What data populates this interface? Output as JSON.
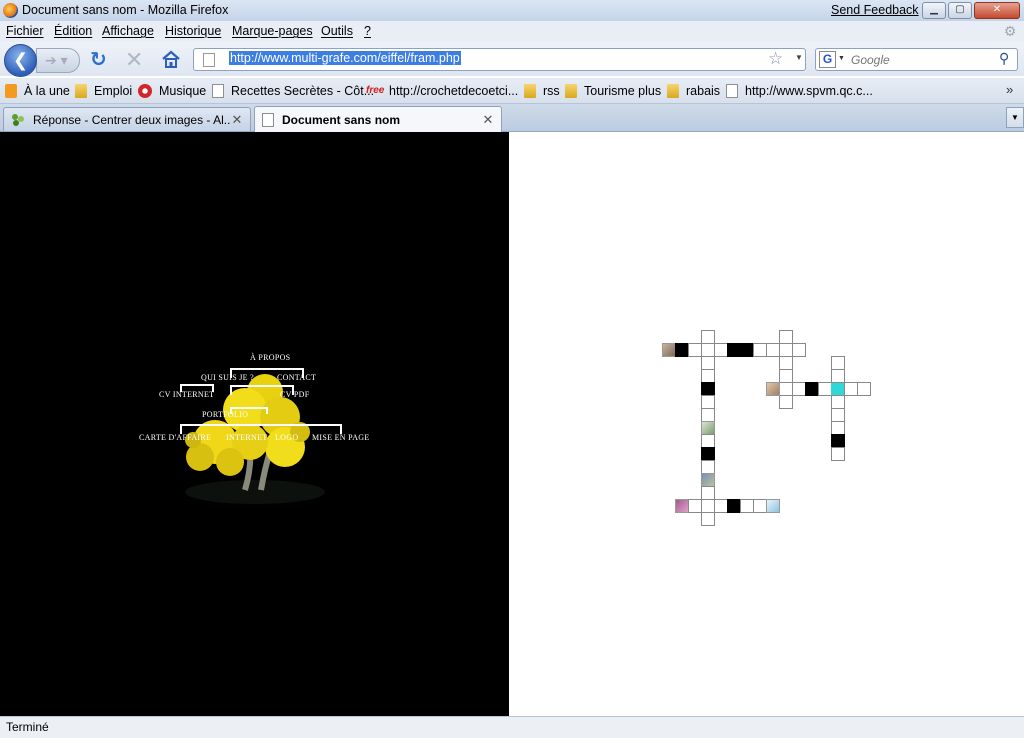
{
  "window": {
    "title": "Document sans nom - Mozilla Firefox",
    "feedback": "Send Feedback",
    "min": "▁",
    "max": "▢",
    "close": "✕"
  },
  "menu": {
    "items": [
      "Fichier",
      "Édition",
      "Affichage",
      "Historique",
      "Marque-pages",
      "Outils",
      "?"
    ]
  },
  "nav": {
    "url": "http://www.multi-grafe.com/eiffel/fram.php",
    "search_placeholder": "Google"
  },
  "bookmarks": {
    "items": [
      {
        "label": "À la une",
        "icon": "rss-icon"
      },
      {
        "label": "Emploi",
        "icon": "folder-icon"
      },
      {
        "label": "Musique",
        "icon": "cbc-icon"
      },
      {
        "label": "Recettes Secrètes - Côt...",
        "icon": "page-icon"
      },
      {
        "label": "http://crochetdecoetci...",
        "icon": "free-icon"
      },
      {
        "label": "rss",
        "icon": "folder-icon"
      },
      {
        "label": "Tourisme plus",
        "icon": "folder-icon"
      },
      {
        "label": "rabais",
        "icon": "folder-icon"
      },
      {
        "label": "http://www.spvm.qc.c...",
        "icon": "page-icon"
      }
    ],
    "more": "»"
  },
  "tabs": [
    {
      "label": "Réponse - Centrer deux images - Al...",
      "active": false
    },
    {
      "label": "Document sans nom",
      "active": true
    }
  ],
  "site_menu": {
    "a_propos": "À PROPOS",
    "qui_suis_je": "QUI SUIS JE ?",
    "contact": "CONTACT",
    "cv_internet": "CV INTERNET",
    "cv_pdf": "CV PDF",
    "portfolio": "PORTFOLIO",
    "carte_affaire": "CARTE D'AFFAIRE",
    "internet": "INTERNET",
    "logo": "LOGO",
    "mise_en_page": "MISE EN PAGE"
  },
  "status": {
    "text": "Terminé"
  },
  "colors": {
    "accent": "#3d7ee3",
    "tree": "#f2dd1a",
    "left_frame_bg": "#000000"
  }
}
